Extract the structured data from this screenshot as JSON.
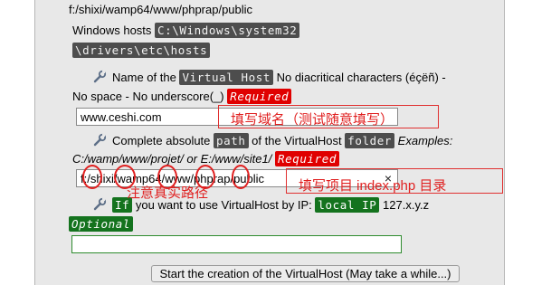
{
  "path_line": "f:/shixi/wamp64/www/phprap/public",
  "hosts": {
    "label": "Windows hosts",
    "path_part1": "C:\\Windows\\system32",
    "path_part2": "\\drivers\\etc\\hosts"
  },
  "name_field": {
    "prefix": "Name of the",
    "code": "Virtual Host",
    "suffix": "No diacritical characters (éçëñ) -",
    "line2": "No space - No underscore(_)",
    "required": "Required",
    "value": "www.ceshi.com"
  },
  "path_field": {
    "prefix": "Complete absolute",
    "code1": "path",
    "middle": "of the VirtualHost",
    "code2": "folder",
    "examples": "Examples:",
    "line2": "C:/wamp/www/projet/ or E:/www/site1/",
    "required": "Required",
    "value": "f:/shixi/wamp64/www/phprap/public",
    "clear": "×"
  },
  "ip_field": {
    "code1": "If",
    "middle": "you want to use VirtualHost by IP:",
    "code2": "local IP",
    "suffix": "127.x.y.z",
    "optional": "Optional",
    "value": ""
  },
  "submit_button": "Start the creation of the VirtualHost (May take a while...)",
  "annotations": {
    "domain_note": "填写域名（测试随意填写）",
    "path_note": "注意真实路径",
    "project_note": "填写项目 index.php 目录"
  },
  "colors": {
    "required_bg": "#e00000",
    "optional_bg": "#14731e",
    "code_bg": "#4d4d4d",
    "annotation": "#e02020"
  }
}
